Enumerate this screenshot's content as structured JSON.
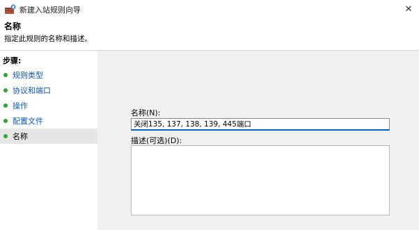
{
  "window": {
    "title": "新建入站规则向导",
    "close_glyph": "✕"
  },
  "header": {
    "heading": "名称",
    "description": "指定此规则的名称和描述。"
  },
  "sidebar": {
    "title": "步骤:",
    "items": [
      {
        "label": "规则类型"
      },
      {
        "label": "协议和端口"
      },
      {
        "label": "操作"
      },
      {
        "label": "配置文件"
      },
      {
        "label": "名称"
      }
    ],
    "current_index": 4
  },
  "form": {
    "name_label": "名称(N):",
    "name_value": "关闭135, 137, 138, 139, 445端口",
    "description_label": "描述(可选)(D):",
    "description_value": ""
  },
  "colors": {
    "step_dot": "#2fa62f",
    "step_link": "#0b57c9",
    "input_focus": "#0067c0"
  }
}
